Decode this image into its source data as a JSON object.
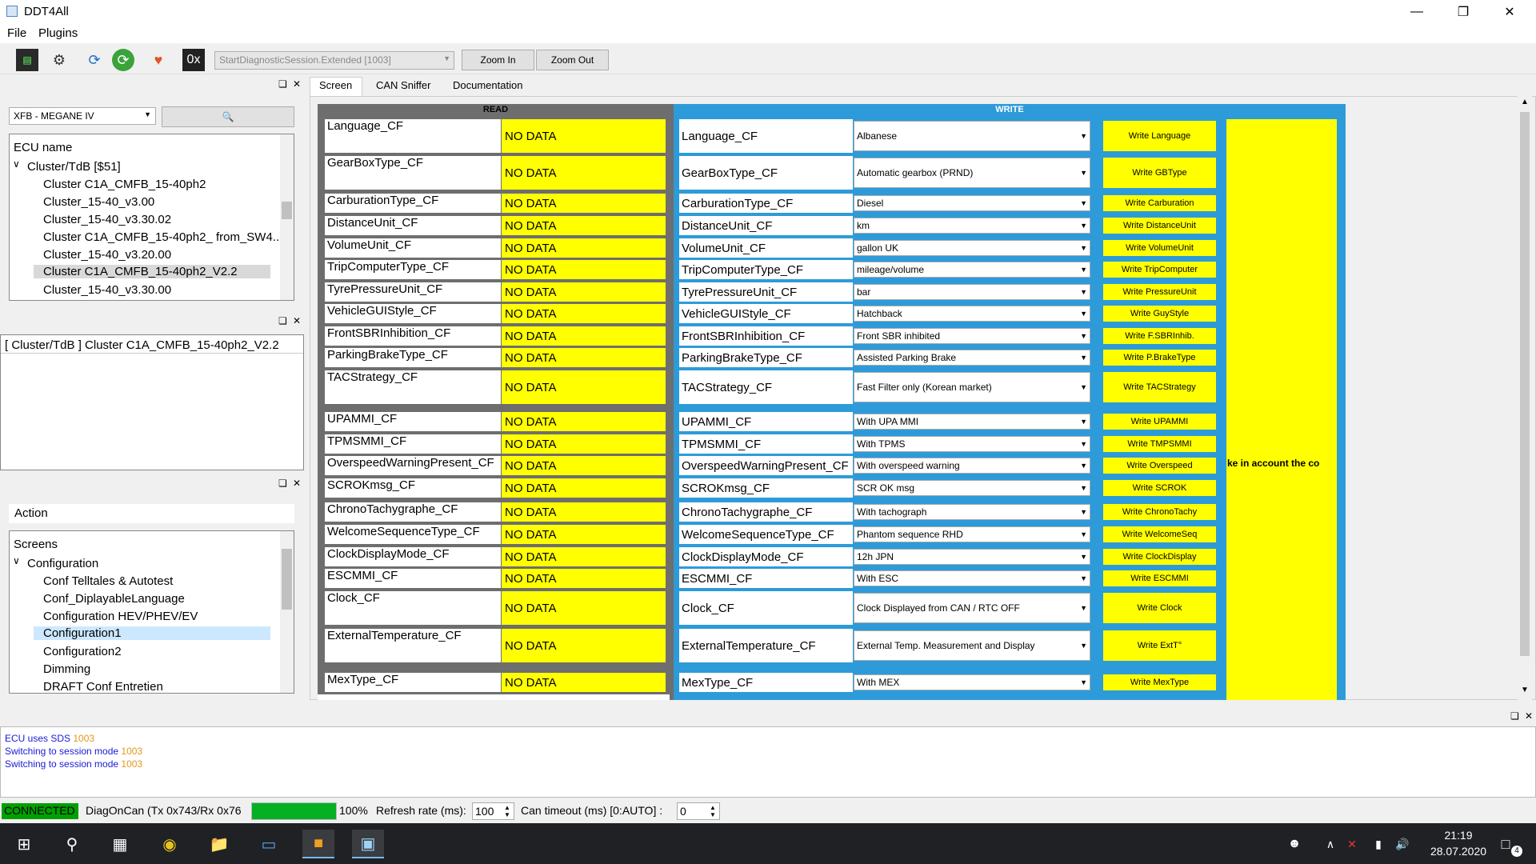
{
  "app": {
    "title": "DDT4All"
  },
  "menu": {
    "file": "File",
    "plugins": "Plugins"
  },
  "toolbar": {
    "session": "StartDiagnosticSession.Extended [1003]",
    "zoom_in": "Zoom In",
    "zoom_out": "Zoom Out",
    "hex": "0x"
  },
  "ecu": {
    "vehicle": "XFB - MEGANE IV",
    "tree_header": "ECU name",
    "group": "Cluster/TdB [$51]",
    "items": [
      "Cluster C1A_CMFB_15-40ph2",
      "Cluster_15-40_v3.00",
      "Cluster_15-40_v3.30.02",
      "Cluster C1A_CMFB_15-40ph2_ from_SW4...",
      "Cluster_15-40_v3.20.00",
      "Cluster C1A_CMFB_15-40ph2_V2.2",
      "Cluster_15-40_v3.30.00"
    ],
    "selected": "[ Cluster/TdB ] Cluster C1A_CMFB_15-40ph2_V2.2"
  },
  "action": {
    "title": "Action",
    "tree_header": "Screens",
    "group": "Configuration",
    "items": [
      "Conf Telltales & Autotest",
      "Conf_DiplayableLanguage",
      "Configuration HEV/PHEV/EV",
      "Configuration1",
      "Configuration2",
      "Dimming",
      "DRAFT Conf Entretien"
    ]
  },
  "tabs": [
    "Screen",
    "CAN Sniffer",
    "Documentation"
  ],
  "screen": {
    "read_header": "READ",
    "write_header": "WRITE",
    "no_data": "NO DATA",
    "side_text": "ke in account the co",
    "rows": [
      {
        "param": "Language_CF",
        "value": "Albanese",
        "button": "Write Language"
      },
      {
        "param": "GearBoxType_CF",
        "value": "Automatic gearbox (PRND)",
        "button": "Write GBType"
      },
      {
        "param": "CarburationType_CF",
        "value": "Diesel",
        "button": "Write Carburation"
      },
      {
        "param": "DistanceUnit_CF",
        "value": "km",
        "button": "Write DistanceUnit"
      },
      {
        "param": "VolumeUnit_CF",
        "value": "gallon UK",
        "button": "Write VolumeUnit"
      },
      {
        "param": "TripComputerType_CF",
        "value": "mileage/volume",
        "button": "Write TripComputer"
      },
      {
        "param": "TyrePressureUnit_CF",
        "value": "bar",
        "button": "Write PressureUnit"
      },
      {
        "param": "VehicleGUIStyle_CF",
        "value": "Hatchback",
        "button": "Write GuyStyle"
      },
      {
        "param": "FrontSBRInhibition_CF",
        "value": "Front SBR inhibited",
        "button": "Write F.SBRInhib."
      },
      {
        "param": "ParkingBrakeType_CF",
        "value": "Assisted Parking Brake",
        "button": "Write P.BrakeType"
      },
      {
        "param": "TACStrategy_CF",
        "value": "Fast Filter only (Korean market)",
        "button": "Write TACStrategy"
      },
      {
        "param": "UPAMMI_CF",
        "value": "With UPA MMI",
        "button": "Write UPAMMI"
      },
      {
        "param": "TPMSMMI_CF",
        "value": "With TPMS",
        "button": "Write TMPSMMI"
      },
      {
        "param": "OverspeedWarningPresent_CF",
        "value": "With overspeed warning",
        "button": "Write Overspeed"
      },
      {
        "param": "SCROKmsg_CF",
        "value": "SCR OK msg",
        "button": "Write SCROK"
      },
      {
        "param": "ChronoTachygraphe_CF",
        "value": "With tachograph",
        "button": "Write ChronoTachy"
      },
      {
        "param": "WelcomeSequenceType_CF",
        "value": "Phantom sequence  RHD",
        "button": "Write WelcomeSeq"
      },
      {
        "param": "ClockDisplayMode_CF",
        "value": "12h JPN",
        "button": "Write ClockDisplay"
      },
      {
        "param": "ESCMMI_CF",
        "value": "With ESC",
        "button": "Write ESCMMI"
      },
      {
        "param": "Clock_CF",
        "value": "Clock Displayed from CAN / RTC OFF",
        "button": "Write Clock"
      },
      {
        "param": "ExternalTemperature_CF",
        "value": "External Temp. Measurement and Display",
        "button": "Write ExtT°"
      },
      {
        "param": "MexType_CF",
        "value": "With MEX",
        "button": "Write MexType"
      }
    ]
  },
  "log": [
    {
      "text": "ECU uses SDS ",
      "code": "1003"
    },
    {
      "text": "Switching to session mode ",
      "code": "1003"
    },
    {
      "text": "Switching to session mode ",
      "code": "1003"
    }
  ],
  "status": {
    "connected": "CONNECTED",
    "can": "DiagOnCan (Tx 0x743/Rx 0x76",
    "progress": "100%",
    "refresh_label": "Refresh rate (ms):",
    "refresh_value": "100",
    "timeout_label": "Can timeout (ms) [0:AUTO] :",
    "timeout_value": "0"
  },
  "taskbar": {
    "time": "21:19",
    "date": "28.07.2020",
    "notifications": "4"
  },
  "colors": {
    "yellow": "#ffff00",
    "write_blue": "#2d9bd9",
    "read_gray": "#6e6e6e",
    "connected": "#00a000"
  }
}
